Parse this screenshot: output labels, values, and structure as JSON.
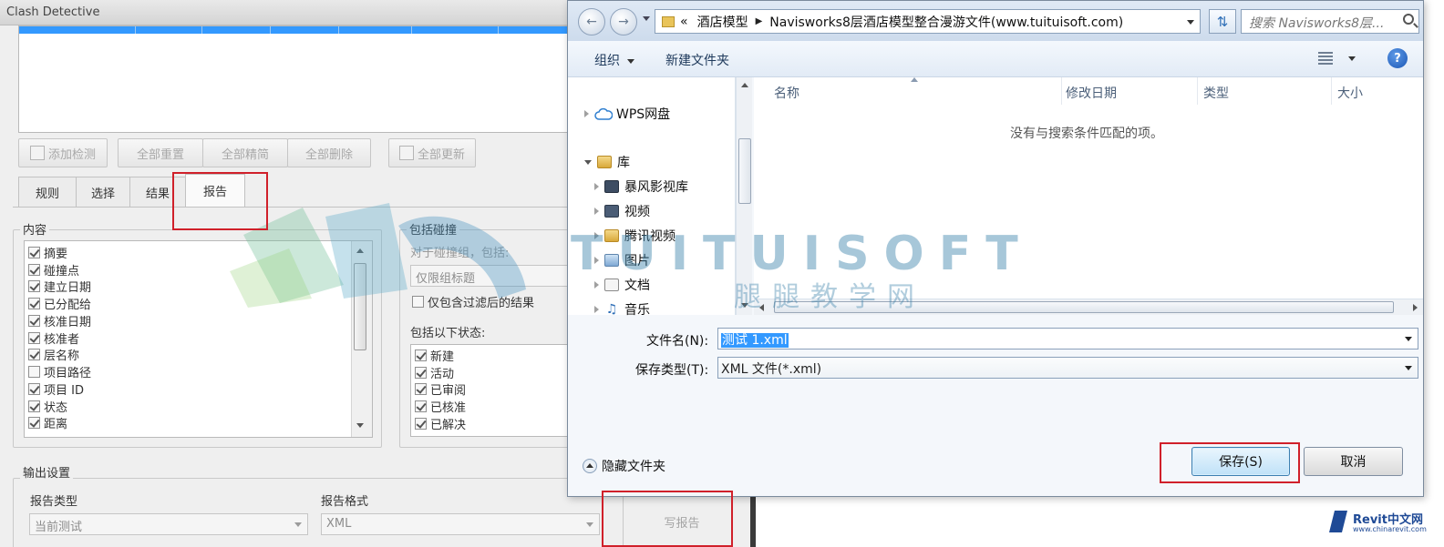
{
  "clash_detective": {
    "title": "Clash Detective",
    "buttons": {
      "add_test": "添加检测",
      "reset_all": "全部重置",
      "compact_all": "全部精简",
      "delete_all": "全部删除",
      "update_all": "全部更新"
    },
    "tabs": [
      "规则",
      "选择",
      "结果",
      "报告"
    ],
    "active_tab": "报告",
    "contents": {
      "title": "内容",
      "items": [
        {
          "label": "摘要",
          "checked": true
        },
        {
          "label": "碰撞点",
          "checked": true
        },
        {
          "label": "建立日期",
          "checked": true
        },
        {
          "label": "已分配给",
          "checked": true
        },
        {
          "label": "核准日期",
          "checked": true
        },
        {
          "label": "核准者",
          "checked": true
        },
        {
          "label": "层名称",
          "checked": true
        },
        {
          "label": "项目路径",
          "checked": false
        },
        {
          "label": "项目 ID",
          "checked": true
        },
        {
          "label": "状态",
          "checked": true
        },
        {
          "label": "距离",
          "checked": true
        }
      ]
    },
    "include_clashes": {
      "title": "包括碰撞",
      "for_groups_label": "对于碰撞组，包括:",
      "group_mode_value": "仅限组标题",
      "filtered_only": {
        "label": "仅包含过滤后的结果",
        "checked": false
      },
      "statuses_label": "包括以下状态:",
      "statuses": [
        {
          "label": "新建",
          "checked": true
        },
        {
          "label": "活动",
          "checked": true
        },
        {
          "label": "已审阅",
          "checked": true
        },
        {
          "label": "已核准",
          "checked": true
        },
        {
          "label": "已解决",
          "checked": true
        }
      ]
    },
    "output": {
      "title": "输出设置",
      "report_type_label": "报告类型",
      "report_type_value": "当前测试",
      "report_format_label": "报告格式",
      "report_format_value": "XML"
    },
    "write_report": "写报告"
  },
  "watermark": {
    "text": "TUITUISOFT",
    "subtext": "腿腿教学网"
  },
  "save_dialog": {
    "breadcrumb": {
      "overflow": "«",
      "parts": [
        "酒店模型",
        "Navisworks8层酒店模型整合漫游文件(www.tuituisoft.com)"
      ]
    },
    "search_placeholder": "搜索 Navisworks8层...",
    "toolbar": {
      "organize": "组织",
      "new_folder": "新建文件夹"
    },
    "nav_tree": [
      {
        "label": "WPS网盘",
        "icon": "cloud-icon"
      },
      {
        "label": "库",
        "icon": "library-icon"
      },
      {
        "label": "暴风影视库",
        "icon": "video-library-icon"
      },
      {
        "label": "视频",
        "icon": "video-icon"
      },
      {
        "label": "腾讯视频",
        "icon": "folder-icon"
      },
      {
        "label": "图片",
        "icon": "pictures-icon"
      },
      {
        "label": "文档",
        "icon": "documents-icon"
      },
      {
        "label": "音乐",
        "icon": "music-icon"
      }
    ],
    "columns": [
      "名称",
      "修改日期",
      "类型",
      "大小"
    ],
    "empty_message": "没有与搜索条件匹配的项。",
    "filename_label": "文件名(N):",
    "filename_value": "测试 1.xml",
    "filetype_label": "保存类型(T):",
    "filetype_value": "XML 文件(*.xml)",
    "hide_folders": "隐藏文件夹",
    "save_button": "保存(S)",
    "cancel_button": "取消"
  },
  "site_logo": {
    "name": "Revit中文网",
    "url_text": "www.chinarevit.com"
  },
  "colors": {
    "highlight_red": "#d0202a",
    "selection_blue": "#3399ff",
    "watermark": "#3c82aa"
  }
}
